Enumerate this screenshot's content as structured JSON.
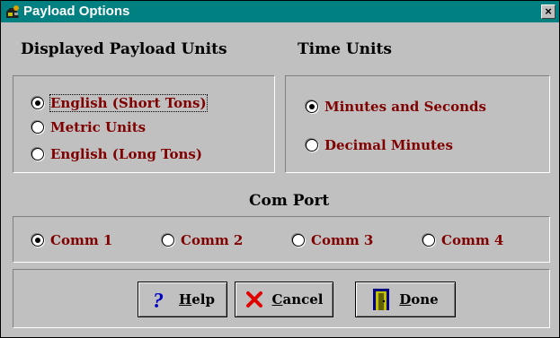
{
  "window": {
    "title": "Payload Options",
    "close_glyph": "×"
  },
  "payload_units": {
    "heading": "Displayed Payload Units",
    "options": [
      {
        "label": "English (Short Tons)",
        "checked": true,
        "focused": true
      },
      {
        "label": "Metric Units",
        "checked": false
      },
      {
        "label": "English (Long Tons)",
        "checked": false
      }
    ]
  },
  "time_units": {
    "heading": "Time Units",
    "options": [
      {
        "label": "Minutes and Seconds",
        "checked": true
      },
      {
        "label": "Decimal Minutes",
        "checked": false
      }
    ]
  },
  "com_port": {
    "heading": "Com Port",
    "options": [
      {
        "label": "Comm 1",
        "checked": true
      },
      {
        "label": "Comm 2",
        "checked": false
      },
      {
        "label": "Comm 3",
        "checked": false
      },
      {
        "label": "Comm 4",
        "checked": false
      }
    ]
  },
  "buttons": {
    "help": {
      "mnemonic": "H",
      "rest": "elp",
      "icon": "question-icon"
    },
    "cancel": {
      "mnemonic": "C",
      "rest": "ancel",
      "icon": "red-x-icon"
    },
    "done": {
      "mnemonic": "D",
      "rest": "one",
      "icon": "door-icon"
    }
  },
  "colors": {
    "titlebar": "#008080",
    "label_text": "#800000",
    "background": "#c0c0c0"
  }
}
